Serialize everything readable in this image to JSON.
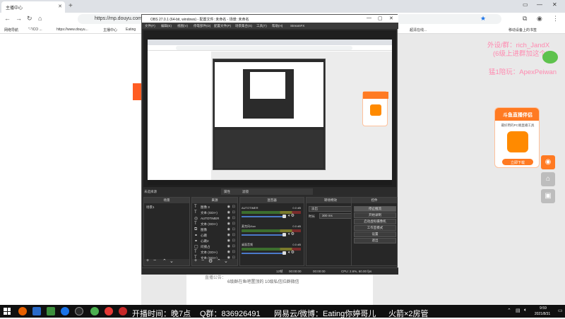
{
  "browser": {
    "tab_title": "主播中心",
    "url": "https://mp.douyu.com/...",
    "bookmarks": [
      "网络导航",
      "\"-\"ICO ...",
      "https://www.douyu...",
      "主播中心",
      "Eating",
      "...",
      "超清在线...",
      "移动设备上的书签"
    ]
  },
  "page": {
    "right_text_1": "外设/群：rich_JandX",
    "right_text_2": "(6级上进群加这个)",
    "right_text_3": "猛1陪玩：ApexPeiwan",
    "ad": {
      "title": "斗鱼直播伴侣",
      "desc": "最好用的PC端直播工具",
      "button": "立即下载",
      "logo_text": "DOUYU"
    },
    "notice_label": "直播公告：",
    "notice_text": "6级群在鱼吧置顶的 10级私信拉群微信"
  },
  "obs": {
    "title": "OBS 27.0.1 (64-bit, windows) - 配置文件: 未命名 - 场景: 未命名",
    "menu": [
      "文件(F)",
      "编辑(E)",
      "视图(V)",
      "停靠部件(D)",
      "配置文件(P)",
      "场景集合(S)",
      "工具(T)",
      "帮助(H)",
      "StreamFX"
    ],
    "status_left": "未选择源",
    "props_tabs": [
      "属性",
      "滤镜"
    ],
    "docks": {
      "scenes_title": "场景",
      "scene_items": [
        "场景1"
      ],
      "sources_title": "来源",
      "sources": [
        {
          "icon": "T",
          "label": "图像 3"
        },
        {
          "icon": "T",
          "label": "文本 (GDI+)"
        },
        {
          "icon": "◎",
          "label": "AUTOTIMER"
        },
        {
          "icon": "T",
          "label": "文本 (GDI+)"
        },
        {
          "icon": "⧉",
          "label": "图像"
        },
        {
          "icon": "⚭",
          "label": "心跳"
        },
        {
          "icon": "⚭",
          "label": "心跳2"
        },
        {
          "icon": "▢",
          "label": "问號占"
        },
        {
          "icon": "T",
          "label": "文本 (GDI+)"
        },
        {
          "icon": "T",
          "label": "文本 (GDI+)"
        }
      ],
      "mixer_title": "混音器",
      "mixer": [
        {
          "name": "AUTOTIMER",
          "db": "0.0 dB"
        },
        {
          "name": "麦克风/Aux",
          "db": "0.0 dB"
        },
        {
          "name": "桌面音频",
          "db": "0.0 dB"
        }
      ],
      "transitions_title": "转场特效",
      "transition_type": "淡出",
      "duration_label": "时长",
      "duration_value": "300 ms",
      "controls_title": "控件",
      "controls": [
        "停止推流",
        "开始录制",
        "启动虚拟摄像机",
        "工作室模式",
        "设置",
        "退出"
      ]
    },
    "statusbar": {
      "dropped": "12帧",
      "live": "00:00:00",
      "rec": "00:00:00",
      "cpu": "CPU: 2.6%, 60.00 fps"
    }
  },
  "taskbar": {
    "overlay": [
      "开播时间：晚7点",
      "Q群：836926491",
      "网易云/微博：Eating你婷哥儿",
      "火箭×2房管"
    ],
    "time": "9:59",
    "date": "2021/8/31"
  },
  "colors": {
    "brand_orange": "#ff7a22",
    "pink_text": "#ff8ab0",
    "obs_bg": "#2b2b2b"
  }
}
